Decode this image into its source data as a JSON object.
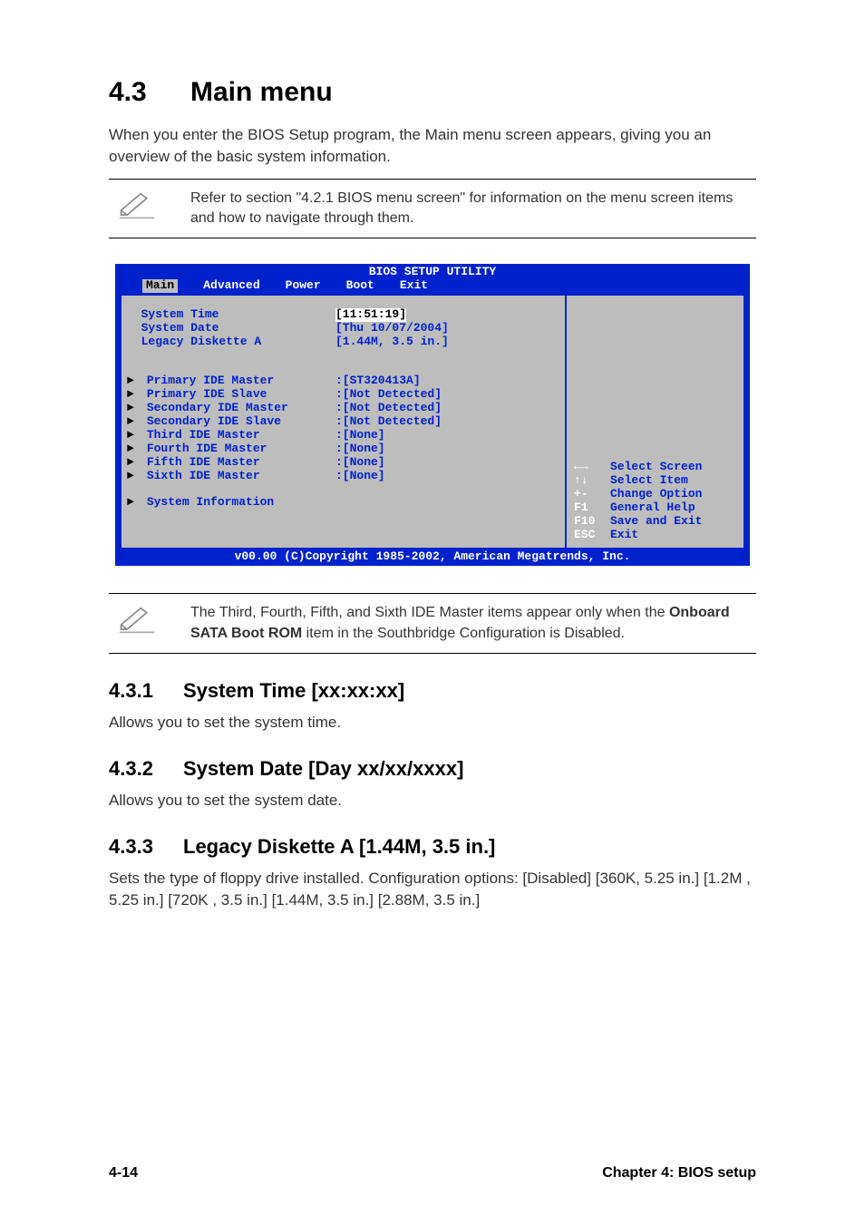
{
  "heading": {
    "num": "4.3",
    "title": "Main menu"
  },
  "intro": "When you enter the BIOS Setup program, the Main menu screen appears, giving you an overview of the basic system information.",
  "note1": "Refer to section \"4.2.1  BIOS menu screen\" for information on the menu screen items and how to navigate through them.",
  "bios": {
    "title": "BIOS SETUP UTILITY",
    "tabs": {
      "main": "Main",
      "advanced": "Advanced",
      "power": "Power",
      "boot": "Boot",
      "exit": "Exit"
    },
    "rows": {
      "system_time": {
        "label": "System Time",
        "value": "[11:51:19]"
      },
      "system_date": {
        "label": "System Date",
        "value": "[Thu 10/07/2004]"
      },
      "legacy_diskette": {
        "label": "Legacy Diskette A",
        "value": "[1.44M, 3.5 in.]"
      },
      "primary_master": {
        "label": "Primary IDE Master",
        "value": ":[ST320413A]"
      },
      "primary_slave": {
        "label": "Primary IDE Slave",
        "value": ":[Not Detected]"
      },
      "secondary_master": {
        "label": "Secondary IDE Master",
        "value": ":[Not Detected]"
      },
      "secondary_slave": {
        "label": "Secondary IDE Slave",
        "value": ":[Not Detected]"
      },
      "third_master": {
        "label": "Third IDE Master",
        "value": ":[None]"
      },
      "fourth_master": {
        "label": "Fourth IDE Master",
        "value": ":[None]"
      },
      "fifth_master": {
        "label": "Fifth IDE Master",
        "value": ":[None]"
      },
      "sixth_master": {
        "label": "Sixth IDE Master",
        "value": ":[None]"
      },
      "system_info": {
        "label": "System Information"
      }
    },
    "help": {
      "r1": {
        "key": "←→",
        "desc": "Select Screen"
      },
      "r2": {
        "key": "↑↓",
        "desc": "Select Item"
      },
      "r3": {
        "key": "+-",
        "desc": "Change Option"
      },
      "r4": {
        "key": "F1",
        "desc": "General Help"
      },
      "r5": {
        "key": "F10",
        "desc": "Save and Exit"
      },
      "r6": {
        "key": "ESC",
        "desc": "Exit"
      }
    },
    "footer": "v00.00 (C)Copyright 1985-2002, American Megatrends, Inc."
  },
  "note2_pre": "The Third, Fourth, Fifth, and Sixth IDE Master items appear only when the ",
  "note2_bold": "Onboard SATA Boot ROM",
  "note2_post": " item in the Southbridge Configuration is Disabled.",
  "sections": {
    "s1": {
      "num": "4.3.1",
      "title": "System Time [xx:xx:xx]",
      "body": "Allows you to set the system time."
    },
    "s2": {
      "num": "4.3.2",
      "title": "System Date [Day xx/xx/xxxx]",
      "body": "Allows you to set the system date."
    },
    "s3": {
      "num": "4.3.3",
      "title": "Legacy Diskette A [1.44M, 3.5 in.]",
      "body": "Sets the type of floppy drive installed. Configuration options: [Disabled] [360K, 5.25 in.] [1.2M , 5.25 in.] [720K , 3.5 in.] [1.44M, 3.5 in.] [2.88M, 3.5 in.]"
    }
  },
  "footer": {
    "page": "4-14",
    "chapter": "Chapter 4: BIOS setup"
  }
}
